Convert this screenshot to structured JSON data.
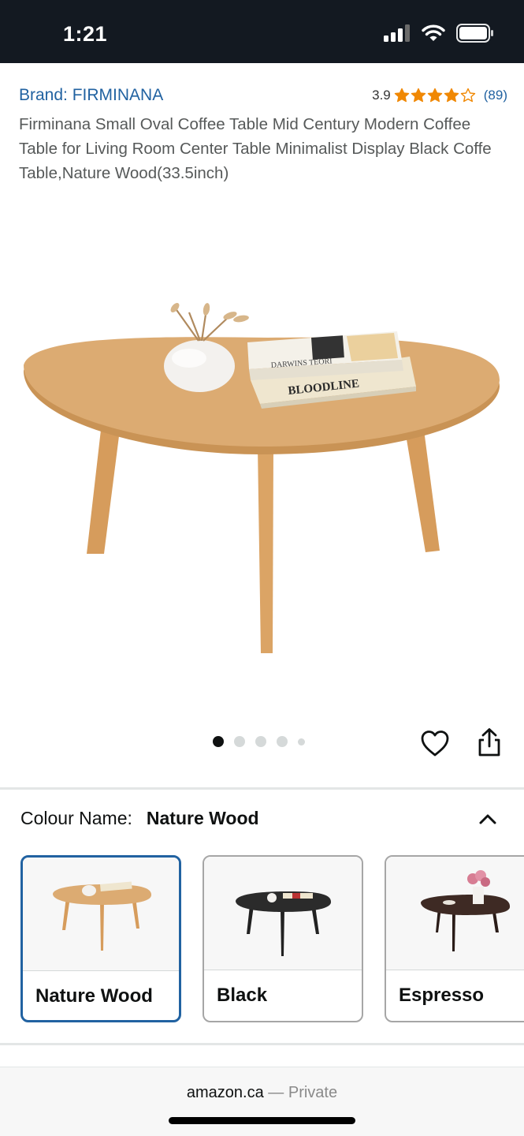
{
  "status": {
    "time": "1:21"
  },
  "product": {
    "brand": "Brand: FIRMINANA",
    "rating": "3.9",
    "stars": 3.9,
    "review_count": "(89)",
    "title": "Firminana Small Oval Coffee Table Mid Century Modern Coffee Table for Living Room Center Table Minimalist Display Black Coffe Table,Nature Wood(33.5inch)",
    "book_top_spine": "DARWINS TEORI",
    "book_bottom_spine": "BLOODLINE"
  },
  "gallery": {
    "image_count": 5,
    "active_index": 0
  },
  "variation": {
    "label": "Colour Name:",
    "selected": "Nature Wood",
    "options": [
      {
        "name": "Nature Wood"
      },
      {
        "name": "Black"
      },
      {
        "name": "Espresso"
      }
    ]
  },
  "browser": {
    "domain": "amazon.ca",
    "separator": " — ",
    "mode": "Private"
  },
  "colors": {
    "status_bar": "#131921",
    "link": "#2162a1",
    "star": "#f08804",
    "wood": "#d9a56b",
    "black_table": "#2b2b2b",
    "espresso_table": "#3e2a24"
  }
}
